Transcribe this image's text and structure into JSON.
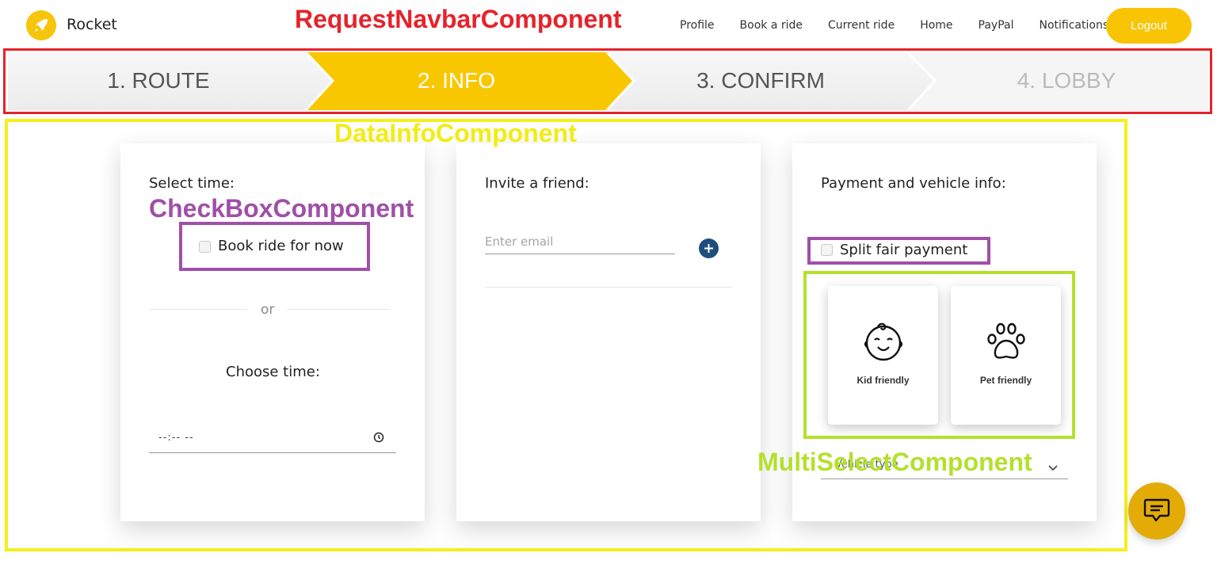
{
  "navbar": {
    "brand": "Rocket",
    "links": [
      "Profile",
      "Book a ride",
      "Current ride",
      "Home",
      "PayPal",
      "Notifications"
    ],
    "logout_label": "Logout",
    "accent_color": "#f8c404"
  },
  "annotations": {
    "navbar_component": "RequestNavbarComponent",
    "data_info_component": "DataInfoComponent",
    "checkbox_component": "CheckBoxComponent",
    "multiselect_component": "MultiSelectComponent"
  },
  "stepper": {
    "steps": [
      "1. ROUTE",
      "2. INFO",
      "3. CONFIRM",
      "4. LOBBY"
    ],
    "active_step": "2. INFO",
    "active_color": "#f9c700"
  },
  "time_card": {
    "title": "Select time:",
    "checkbox_label": "Book ride for now",
    "or_label": "or",
    "choose_time_label": "Choose time:",
    "time_placeholder": "--:-- --"
  },
  "invite_card": {
    "title": "Invite a friend:",
    "email_placeholder": "Enter email"
  },
  "payment_card": {
    "title": "Payment and vehicle info:",
    "split_label": "Split fair payment",
    "options": [
      "Kid friendly",
      "Pet friendly"
    ],
    "vehicle_select_placeholder": "Vehicle type"
  }
}
